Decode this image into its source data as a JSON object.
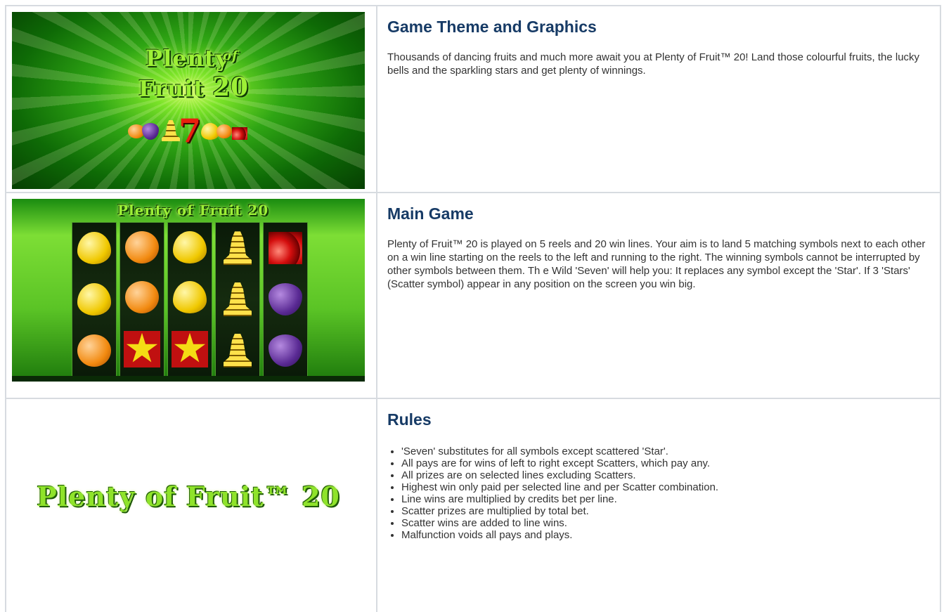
{
  "sections": [
    {
      "heading": "Game Theme and Graphics",
      "body": "Thousands of dancing fruits and much more await you at Plenty of Fruit™ 20! Land those colourful fruits, the lucky bells and the sparkling stars and get plenty of winnings.",
      "image": {
        "logo_line1": "Plenty",
        "logo_of": "of",
        "logo_line2": "Fruit",
        "logo_number": "20",
        "logo_seven": "7"
      }
    },
    {
      "heading": "Main Game",
      "body": "Plenty of Fruit™ 20 is played on 5 reels and 20 win lines. Your aim is to land 5 matching symbols next to each other on a win line starting on the reels to the left and running to the right. The winning symbols cannot be interrupted by other symbols between them. Th e Wild 'Seven' will help you: It replaces any symbol except the 'Star'. If 3 'Stars' (Scatter symbol) appear in any position on the screen you win big.",
      "image": {
        "title": "Plenty of Fruit 20",
        "reels": [
          [
            "lemon",
            "lemon",
            "orange"
          ],
          [
            "orange",
            "orange",
            "star"
          ],
          [
            "lemon",
            "lemon",
            "star"
          ],
          [
            "bell",
            "bell",
            "bell"
          ],
          [
            "cherry",
            "plum",
            "plum"
          ]
        ]
      }
    },
    {
      "heading": "Rules",
      "image": {
        "logo_text": "Plenty of Fruit™ 20"
      },
      "rules": [
        "'Seven' substitutes for all symbols except scattered 'Star'.",
        "All pays are for wins of left to right except Scatters, which pay any.",
        "All prizes are on selected lines excluding Scatters.",
        "Highest win only paid per selected line and per Scatter combination.",
        "Line wins are multiplied by credits bet per line.",
        "Scatter prizes are multiplied by total bet.",
        "Scatter wins are added to line wins.",
        "Malfunction voids all pays and plays."
      ]
    }
  ]
}
